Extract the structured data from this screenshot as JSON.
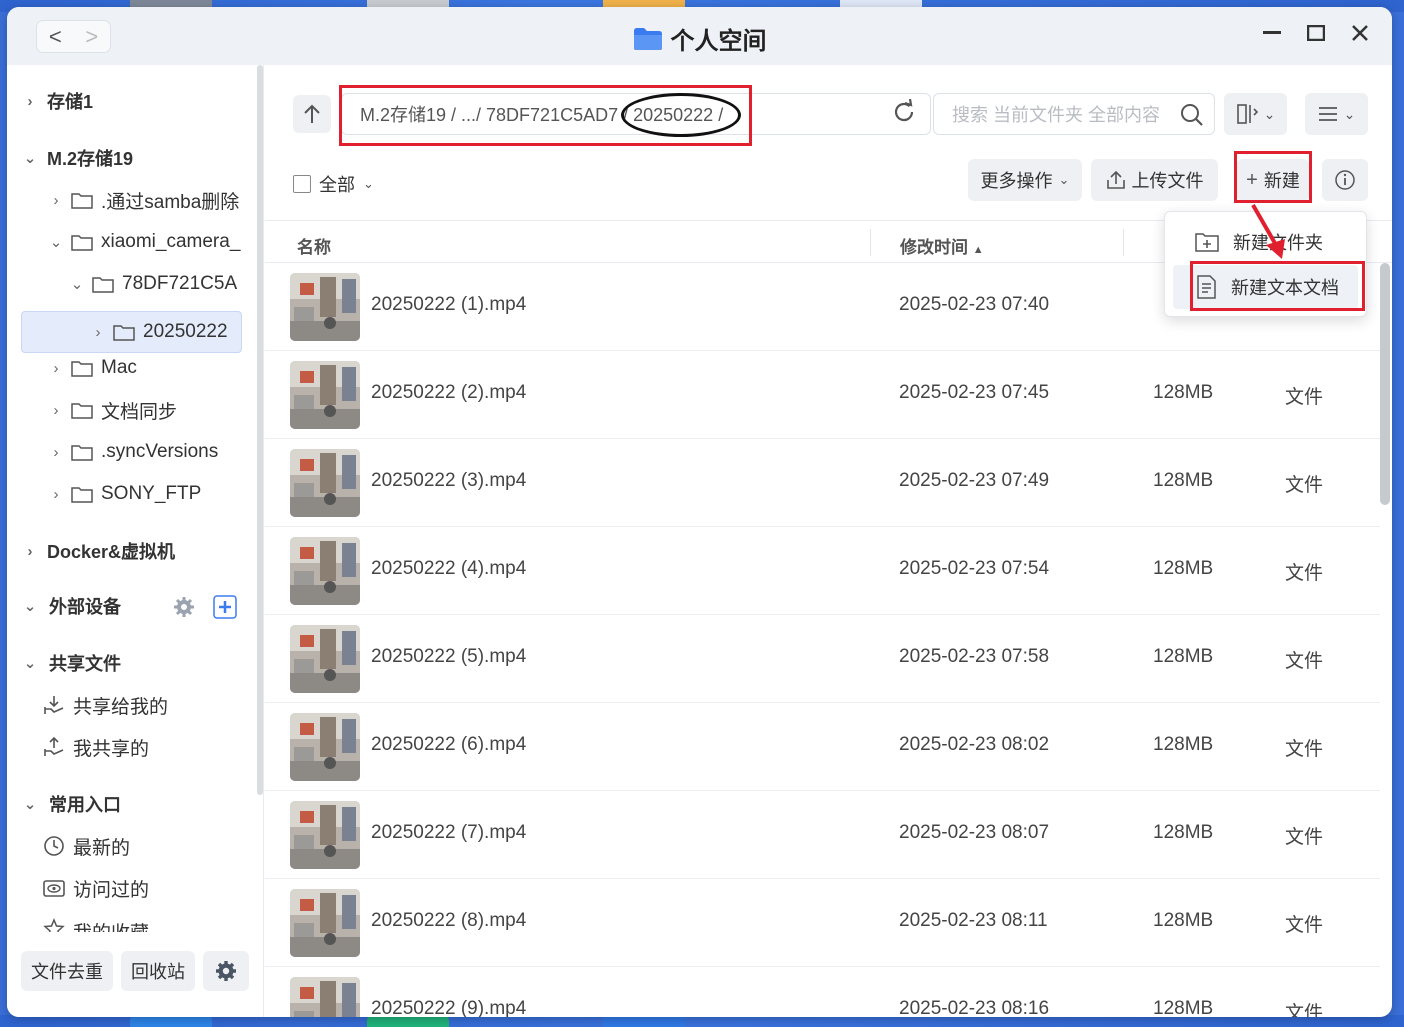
{
  "window": {
    "title": "个人空间",
    "nav_back": "<",
    "nav_forward": ">"
  },
  "sidebar": {
    "items": [
      {
        "label": "存储1"
      },
      {
        "label": "M.2存储19"
      },
      {
        "label": ".通过samba删除"
      },
      {
        "label": "xiaomi_camera_"
      },
      {
        "label": "78DF721C5A"
      },
      {
        "label": "20250222"
      },
      {
        "label": "Mac"
      },
      {
        "label": "文档同步"
      },
      {
        "label": ".syncVersions"
      },
      {
        "label": "SONY_FTP"
      },
      {
        "label": "Docker&虚拟机"
      },
      {
        "label": "外部设备"
      },
      {
        "label": "共享文件"
      },
      {
        "label": "共享给我的"
      },
      {
        "label": "我共享的"
      },
      {
        "label": "常用入口"
      },
      {
        "label": "最新的"
      },
      {
        "label": "访问过的"
      },
      {
        "label": "我的收藏"
      }
    ],
    "bottom": {
      "dedupe": "文件去重",
      "recycle": "回收站"
    }
  },
  "toolbar": {
    "path": "M.2存储19 / .../ 78DF721C5AD7 / 20250222 /",
    "search_placeholder": "搜索 当前文件夹 全部内容",
    "select_all": "全部",
    "more_ops": "更多操作",
    "upload": "上传文件",
    "new": "新建"
  },
  "table": {
    "col_name": "名称",
    "col_mtime": "修改时间",
    "rows": [
      {
        "name": "20250222 (1).mp4",
        "mtime": "2025-02-23 07:40",
        "size": "",
        "type": ""
      },
      {
        "name": "20250222 (2).mp4",
        "mtime": "2025-02-23 07:45",
        "size": "128MB",
        "type": "文件"
      },
      {
        "name": "20250222 (3).mp4",
        "mtime": "2025-02-23 07:49",
        "size": "128MB",
        "type": "文件"
      },
      {
        "name": "20250222 (4).mp4",
        "mtime": "2025-02-23 07:54",
        "size": "128MB",
        "type": "文件"
      },
      {
        "name": "20250222 (5).mp4",
        "mtime": "2025-02-23 07:58",
        "size": "128MB",
        "type": "文件"
      },
      {
        "name": "20250222 (6).mp4",
        "mtime": "2025-02-23 08:02",
        "size": "128MB",
        "type": "文件"
      },
      {
        "name": "20250222 (7).mp4",
        "mtime": "2025-02-23 08:07",
        "size": "128MB",
        "type": "文件"
      },
      {
        "name": "20250222 (8).mp4",
        "mtime": "2025-02-23 08:11",
        "size": "128MB",
        "type": "文件"
      },
      {
        "name": "20250222 (9).mp4",
        "mtime": "2025-02-23 08:16",
        "size": "128MB",
        "type": "文件"
      }
    ]
  },
  "dropdown": {
    "new_folder": "新建文件夹",
    "new_text_doc": "新建文本文档"
  },
  "colors": {
    "annotation_red": "#e0202e",
    "accent_blue": "#3b7bf0",
    "selected_bg": "#e4ebfb"
  }
}
